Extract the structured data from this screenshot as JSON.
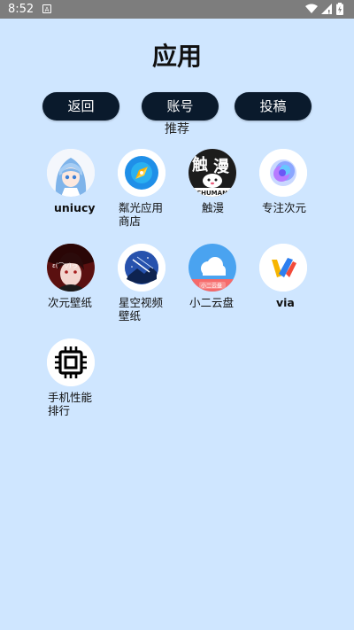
{
  "status_bar": {
    "time": "8:52",
    "notification_glyph": "A"
  },
  "header": {
    "title": "应用"
  },
  "nav": {
    "back_label": "返回",
    "account_label": "账号",
    "submit_label": "投稿"
  },
  "section": {
    "label": "推荐"
  },
  "apps": [
    {
      "line1": "uniucy",
      "line2": "",
      "icon": "anime-girl-blue-hair-icon"
    },
    {
      "line1": "粼光应用",
      "line2": "商店",
      "icon": "app-store-icon"
    },
    {
      "line1": "触漫",
      "line2": "",
      "icon": "chuman-icon"
    },
    {
      "line1": "专注次元",
      "line2": "",
      "icon": "focus-dimension-icon"
    },
    {
      "line1": "次元壁纸",
      "line2": "",
      "icon": "anime-wallpaper-icon"
    },
    {
      "line1": "星空视频",
      "line2": "壁纸",
      "icon": "starry-sky-icon"
    },
    {
      "line1": "小二云盘",
      "line2": "",
      "icon": "cloud-drive-icon"
    },
    {
      "line1": "via",
      "line2": "",
      "icon": "via-browser-icon"
    },
    {
      "line1": "手机性能",
      "line2": "排行",
      "icon": "cpu-chip-icon"
    }
  ],
  "colors": {
    "background": "#cfe6ff",
    "button": "#0a1a2c",
    "status_bar": "#7d7d7d"
  }
}
